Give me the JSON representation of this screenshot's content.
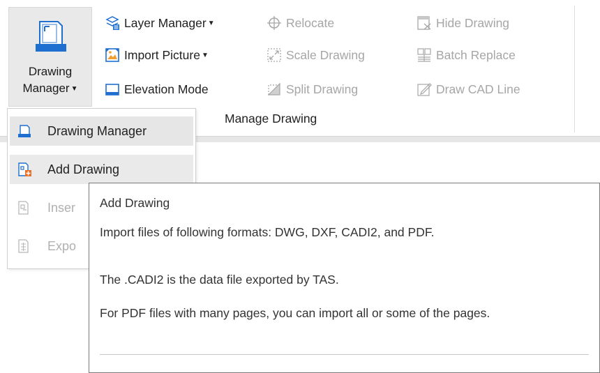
{
  "ribbon": {
    "big_button": {
      "label_line1": "Drawing",
      "label_line2": "Manager",
      "icon": "drawing-manager-icon"
    },
    "items": [
      {
        "label": "Layer Manager",
        "has_dropdown": true,
        "icon": "layer-manager-icon",
        "enabled": true
      },
      {
        "label": "Import Picture",
        "has_dropdown": true,
        "icon": "import-picture-icon",
        "enabled": true
      },
      {
        "label": "Elevation Mode",
        "has_dropdown": false,
        "icon": "elevation-mode-icon",
        "enabled": true
      },
      {
        "label": "Relocate",
        "icon": "relocate-icon",
        "enabled": false
      },
      {
        "label": "Scale Drawing",
        "icon": "scale-drawing-icon",
        "enabled": false
      },
      {
        "label": "Split Drawing",
        "icon": "split-drawing-icon",
        "enabled": false
      },
      {
        "label": "Hide Drawing",
        "icon": "hide-drawing-icon",
        "enabled": false
      },
      {
        "label": "Batch Replace",
        "icon": "batch-replace-icon",
        "enabled": false
      },
      {
        "label": "Draw CAD Line",
        "icon": "draw-cad-line-icon",
        "enabled": false
      }
    ],
    "group_label": "Manage Drawing"
  },
  "dropdown_menu": {
    "items": [
      {
        "label": "Drawing Manager",
        "icon": "drawing-manager-icon",
        "state": "selected"
      },
      {
        "label": "Add Drawing",
        "icon": "add-drawing-icon",
        "state": "hover"
      },
      {
        "label": "Inser",
        "icon": "insert-drawing-icon",
        "state": "disabled"
      },
      {
        "label": "Expo",
        "icon": "export-drawing-icon",
        "state": "disabled"
      }
    ]
  },
  "tooltip": {
    "title": "Add Drawing",
    "line1": "Import files of following formats: DWG, DXF, CADI2, and PDF.",
    "line2": "The .CADI2 is the data file exported by TAS.",
    "line3": "For PDF files with many pages, you can import all or some of the pages."
  },
  "colors": {
    "accent_blue": "#1e6fd0",
    "disabled_text": "#a6a6a6",
    "selected_bg": "#e6e6e6"
  }
}
